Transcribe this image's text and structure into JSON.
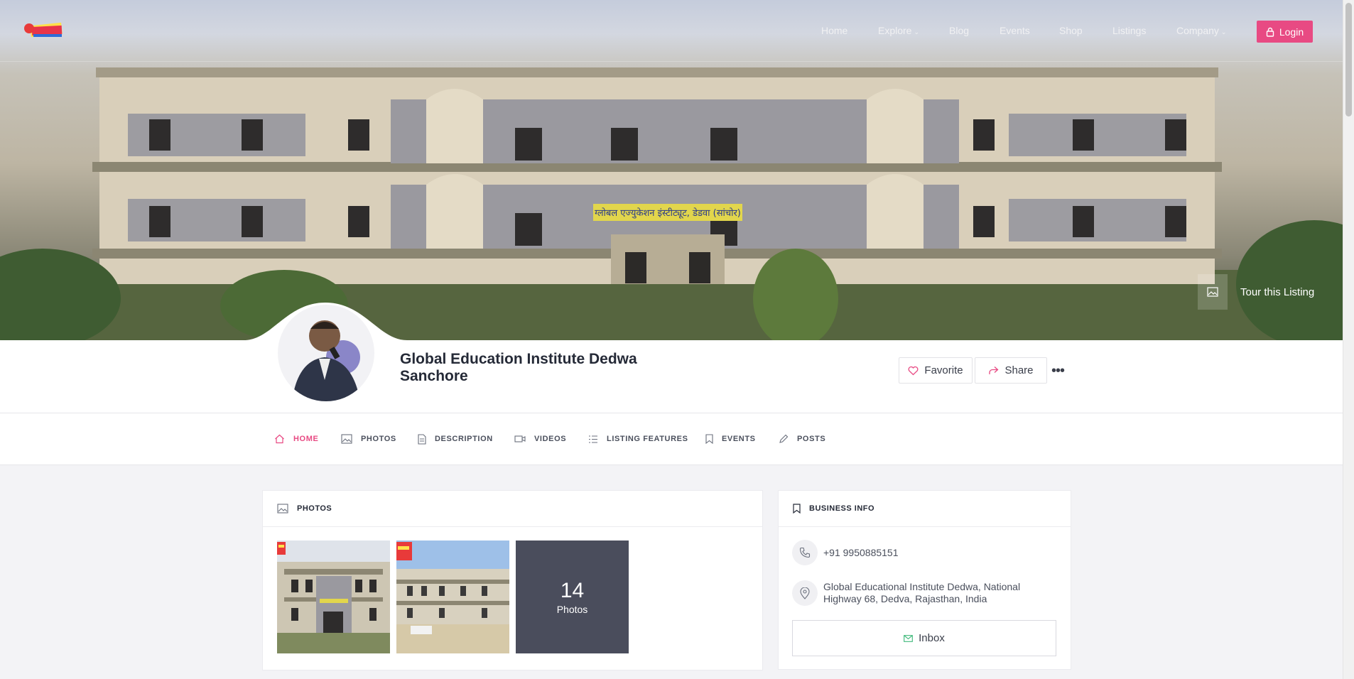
{
  "nav": {
    "logo_alt": "Sanchore logo",
    "items": [
      {
        "label": "Home"
      },
      {
        "label": "Explore"
      },
      {
        "label": "Blog"
      },
      {
        "label": "Events"
      },
      {
        "label": "Shop"
      },
      {
        "label": "Listings"
      },
      {
        "label": "Company"
      }
    ],
    "login_label": "Login"
  },
  "hero": {
    "tour_label": "Tour this Listing",
    "building_sign": "ग्लोबल एज्युकेशन इंस्टीट्यूट, डेडवा (सांचोर)"
  },
  "listing": {
    "title": "Global Education Institute Dedwa Sanchore",
    "favorite_label": "Favorite",
    "share_label": "Share",
    "more_label": "•••"
  },
  "tabs": [
    {
      "label": "HOME",
      "icon": "home-icon"
    },
    {
      "label": "PHOTOS",
      "icon": "image-icon"
    },
    {
      "label": "DESCRIPTION",
      "icon": "document-icon"
    },
    {
      "label": "VIDEOS",
      "icon": "video-icon"
    },
    {
      "label": "LISTING FEATURES",
      "icon": "list-icon"
    },
    {
      "label": "EVENTS",
      "icon": "bookmark-icon"
    },
    {
      "label": "POSTS",
      "icon": "pencil-icon"
    }
  ],
  "photos": {
    "header": "PHOTOS",
    "more_count": "14",
    "more_label": "Photos"
  },
  "business_info": {
    "header": "BUSINESS INFO",
    "phone": "+91 9950885151",
    "address": "Global Educational Institute Dedwa, National Highway 68, Dedva, Rajasthan, India",
    "inbox_label": "Inbox"
  },
  "colors": {
    "accent": "#e84a83",
    "page_bg": "#f3f3f6"
  }
}
